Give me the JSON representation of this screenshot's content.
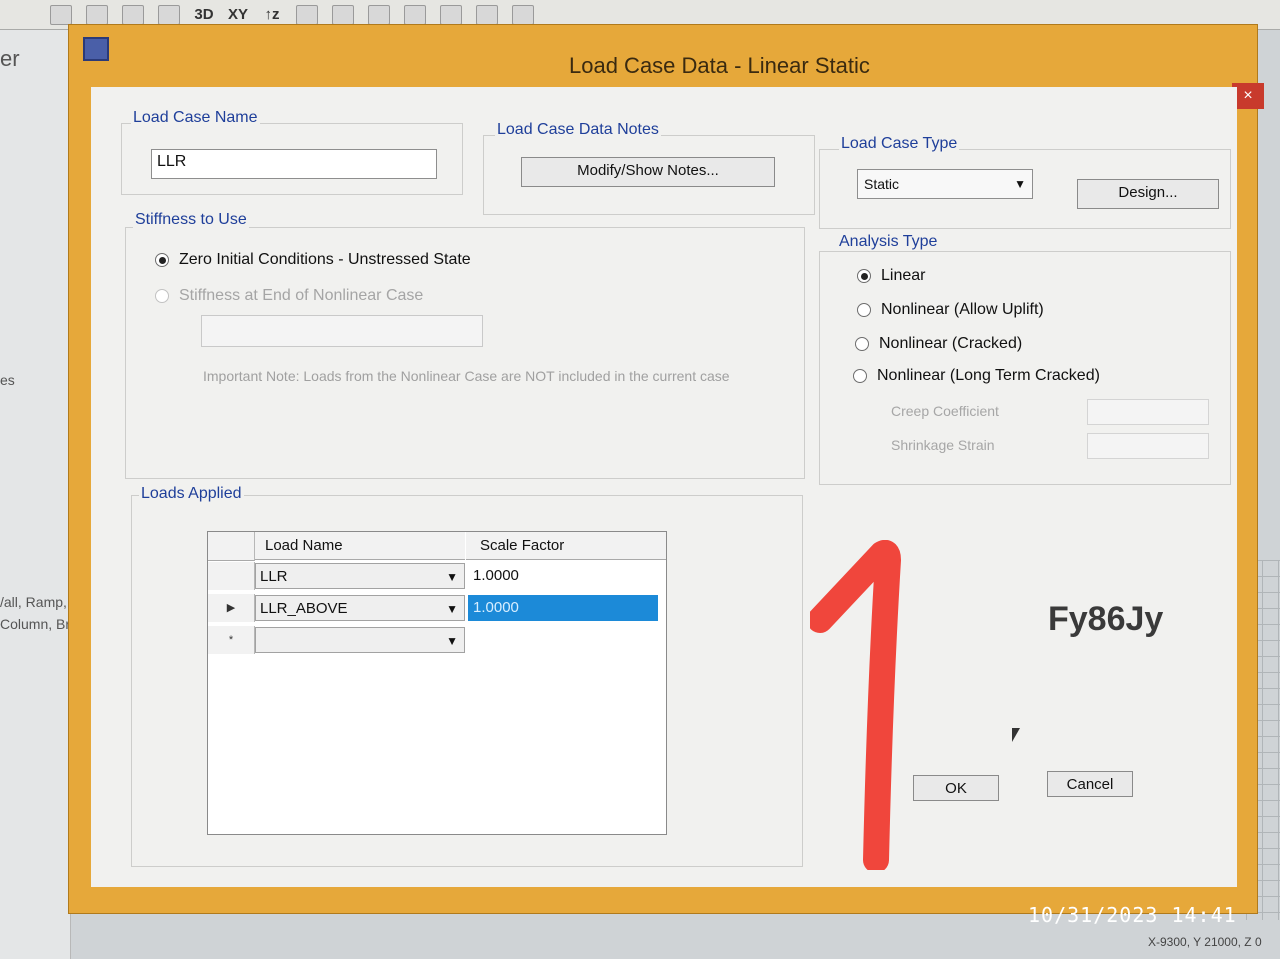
{
  "toolbar": {
    "items": [
      "3D",
      "XY",
      "↑z"
    ]
  },
  "left_panel": {
    "fragments": [
      "er",
      "es",
      "/all, Ramp,",
      "Column, Br"
    ]
  },
  "dialog": {
    "title": "Load Case Data - Linear Static",
    "help": "?",
    "close": "×"
  },
  "load_case_name": {
    "label": "Load Case Name",
    "value": "LLR"
  },
  "notes": {
    "label": "Load Case Data Notes",
    "button": "Modify/Show Notes..."
  },
  "load_case_type": {
    "label": "Load Case Type",
    "selected": "Static",
    "design_button": "Design..."
  },
  "stiffness": {
    "label": "Stiffness to Use",
    "option1": "Zero Initial Conditions - Unstressed State",
    "option2": "Stiffness at End of Nonlinear Case",
    "note": "Important Note:  Loads from the Nonlinear Case are NOT included in the current case"
  },
  "analysis_type": {
    "label": "Analysis Type",
    "options": [
      "Linear",
      "Nonlinear (Allow Uplift)",
      "Nonlinear (Cracked)",
      "Nonlinear (Long Term Cracked)"
    ],
    "creep_label": "Creep Coefficient",
    "shrinkage_label": "Shrinkage Strain"
  },
  "loads_applied": {
    "label": "Loads Applied",
    "col_name": "Load Name",
    "col_scale": "Scale Factor",
    "rows": [
      {
        "indicator": "",
        "name": "LLR",
        "scale": "1.0000"
      },
      {
        "indicator": "▶",
        "name": "LLR_ABOVE",
        "scale": "1.0000"
      },
      {
        "indicator": "*",
        "name": "",
        "scale": ""
      }
    ]
  },
  "buttons": {
    "ok": "OK",
    "cancel": "Cancel"
  },
  "overlay": {
    "watermark": "Fy86Jy",
    "timestamp": "10/31/2023   14:41",
    "coords": "X-9300, Y 21000, Z 0"
  },
  "colors": {
    "dialog_frame": "#e6a83a",
    "group_label": "#1f3f9a",
    "selection": "#1c8ad8",
    "marker": "#f0463c"
  }
}
